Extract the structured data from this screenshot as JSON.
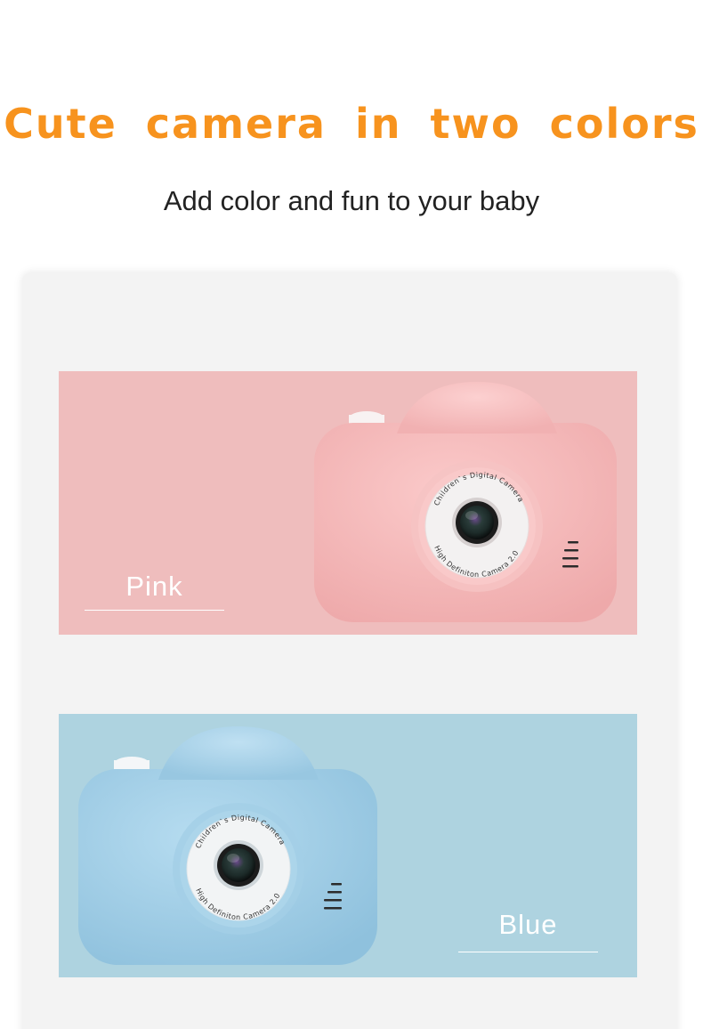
{
  "header": {
    "title": "Cute camera in two colors",
    "subtitle": "Add color and fun to your baby"
  },
  "variants": [
    {
      "label": "Pink",
      "background_color": "#efbdbd",
      "body_color": "#f4bcbc",
      "lens_ring_top_text": "Children`s Digital Camera",
      "lens_ring_bottom_text": "High Definiton Camera 2.0"
    },
    {
      "label": "Blue",
      "background_color": "#aed3e0",
      "body_color": "#a9d4ea",
      "lens_ring_top_text": "Children`s Digital Camera",
      "lens_ring_bottom_text": "High Definiton Camera 2.0"
    }
  ],
  "colors": {
    "title": "#f7931e",
    "subtitle": "#222222",
    "panel": "#f3f3f3"
  }
}
